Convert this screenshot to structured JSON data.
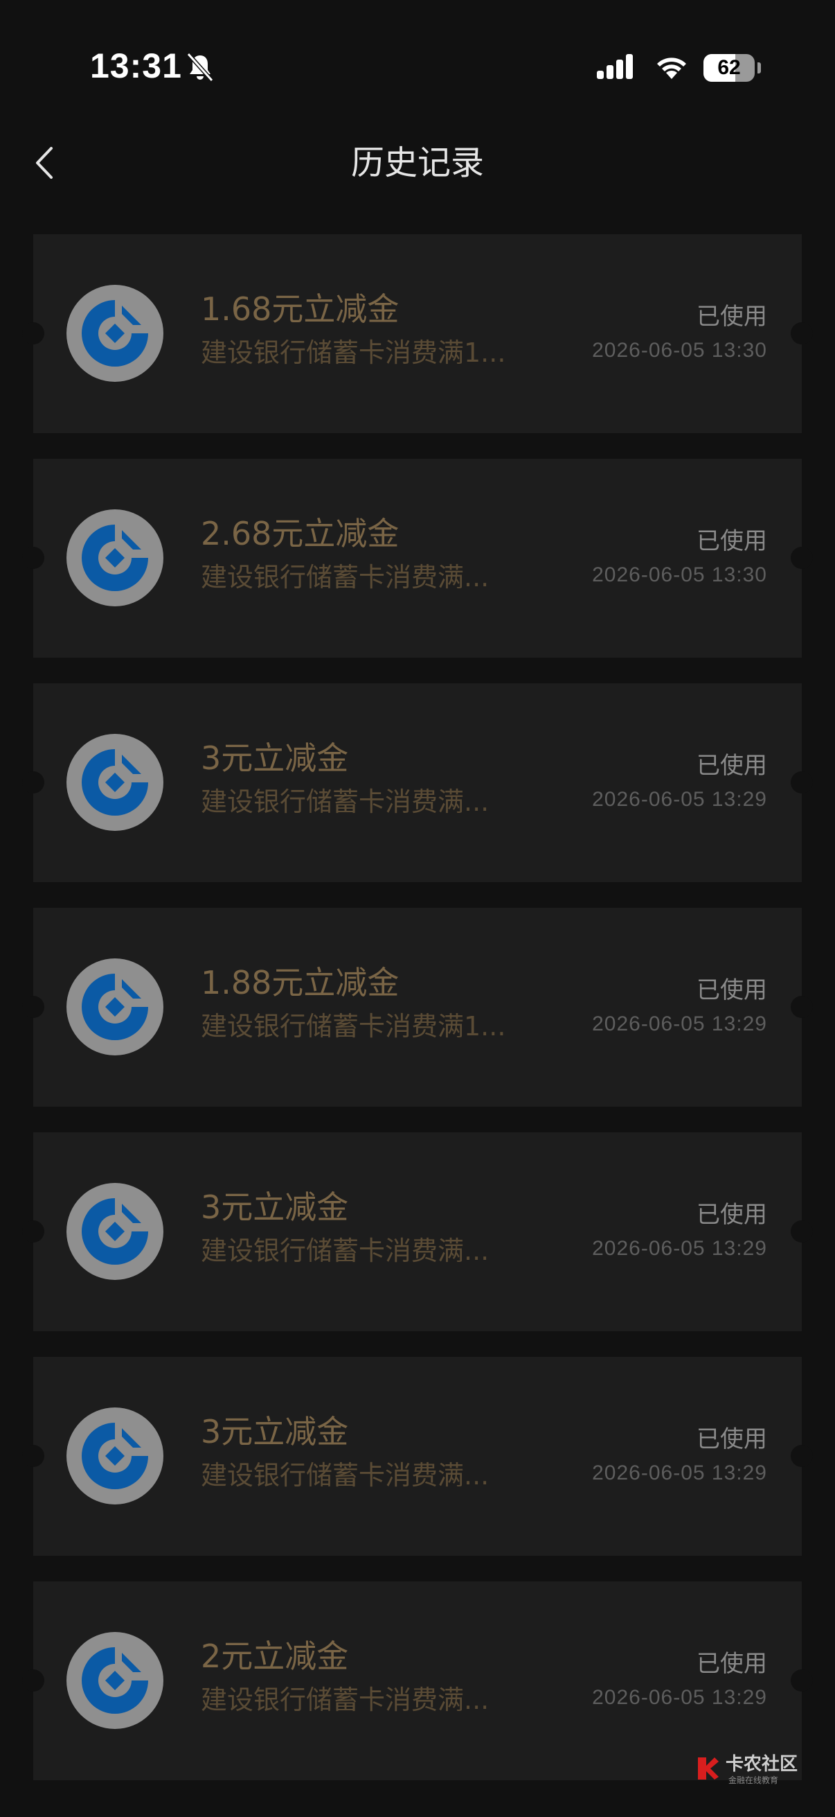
{
  "status_bar": {
    "time": "13:31",
    "battery": "62",
    "battery_level": 0.62
  },
  "nav": {
    "title": "历史记录",
    "back_icon": "chevron-left-icon"
  },
  "colors": {
    "background": "#111111",
    "card": "#1d1d1d",
    "amount": "#7a6546",
    "bank_blue": "#0b5aa5"
  },
  "coupons": [
    {
      "amount": "1.68元立减金",
      "desc": "建设银行储蓄卡消费满1...",
      "status": "已使用",
      "date": "2026-06-05 13:30"
    },
    {
      "amount": "2.68元立减金",
      "desc": "建设银行储蓄卡消费满...",
      "status": "已使用",
      "date": "2026-06-05 13:30"
    },
    {
      "amount": "3元立减金",
      "desc": "建设银行储蓄卡消费满...",
      "status": "已使用",
      "date": "2026-06-05 13:29"
    },
    {
      "amount": "1.88元立减金",
      "desc": "建设银行储蓄卡消费满1...",
      "status": "已使用",
      "date": "2026-06-05 13:29"
    },
    {
      "amount": "3元立减金",
      "desc": "建设银行储蓄卡消费满...",
      "status": "已使用",
      "date": "2026-06-05 13:29"
    },
    {
      "amount": "3元立减金",
      "desc": "建设银行储蓄卡消费满...",
      "status": "已使用",
      "date": "2026-06-05 13:29"
    },
    {
      "amount": "2元立减金",
      "desc": "建设银行储蓄卡消费满...",
      "status": "已使用",
      "date": "2026-06-05 13:29"
    }
  ],
  "watermark": {
    "title": "卡农社区",
    "subtitle": "金融在线教育"
  }
}
